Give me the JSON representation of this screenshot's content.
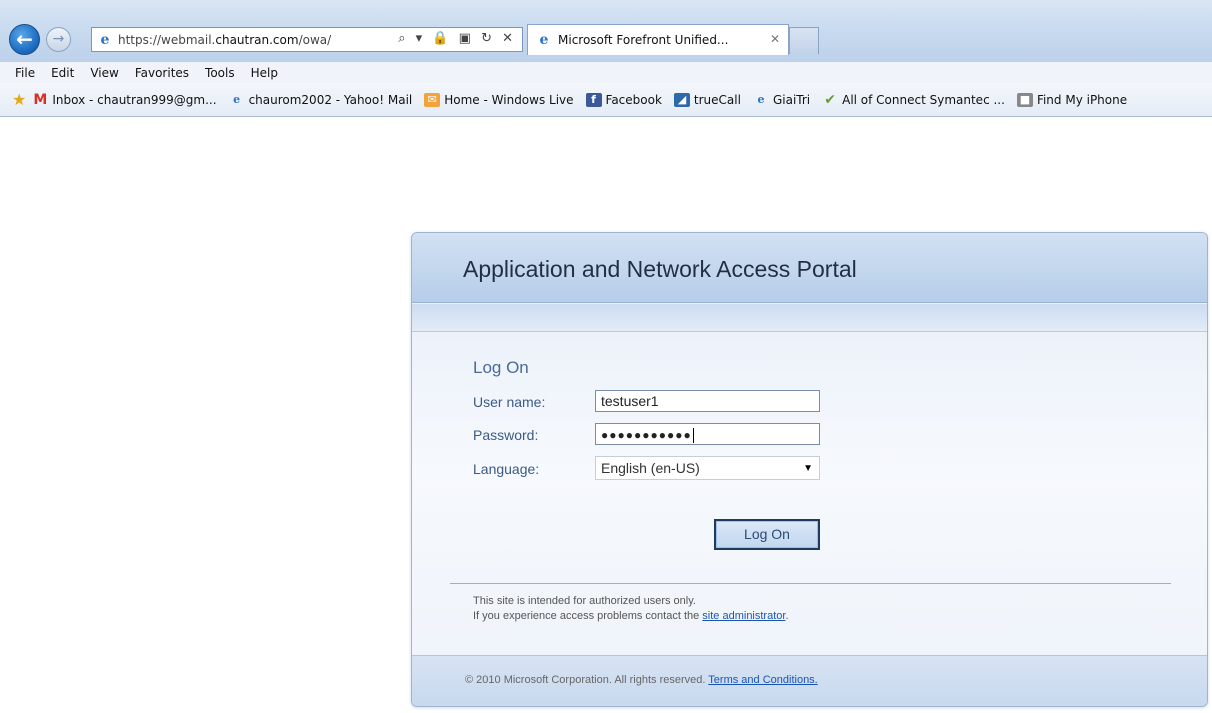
{
  "browser": {
    "url_prefix": "https://webmail.",
    "url_domain": "chautran.com",
    "url_path": "/owa/",
    "address_tools": "⌕ ▾ 🔒 ▣ ↻ ✕",
    "tab_title": "Microsoft Forefront Unified...",
    "tab_close": "✕"
  },
  "menu": [
    "File",
    "Edit",
    "View",
    "Favorites",
    "Tools",
    "Help"
  ],
  "favorites": [
    {
      "label": "Inbox - chautran999@gm...",
      "icon": "gmail-icon"
    },
    {
      "label": "chaurom2002 - Yahoo! Mail",
      "icon": "ie-icon"
    },
    {
      "label": "Home - Windows Live",
      "icon": "hotmail-icon"
    },
    {
      "label": "Facebook",
      "icon": "facebook-icon"
    },
    {
      "label": "trueCall",
      "icon": "truecall-icon"
    },
    {
      "label": "GiaiTri",
      "icon": "ie-icon"
    },
    {
      "label": "All of Connect Symantec ...",
      "icon": "check-icon"
    },
    {
      "label": "Find My iPhone",
      "icon": "apple-icon"
    }
  ],
  "portal": {
    "title": "Application and Network Access Portal",
    "logon_heading": "Log On",
    "username_label": "User name:",
    "username_value": "testuser1",
    "password_label": "Password:",
    "password_mask": "●●●●●●●●●●●",
    "language_label": "Language:",
    "language_value": "English (en-US)",
    "logon_button": "Log On",
    "notice_line1": "This site is intended for authorized users only.",
    "notice_line2_prefix": "If you experience access problems contact the ",
    "notice_link": "site administrator",
    "notice_line2_suffix": ".",
    "footer_text": "© 2010 Microsoft Corporation. All rights reserved. ",
    "footer_link": "Terms and Conditions."
  }
}
